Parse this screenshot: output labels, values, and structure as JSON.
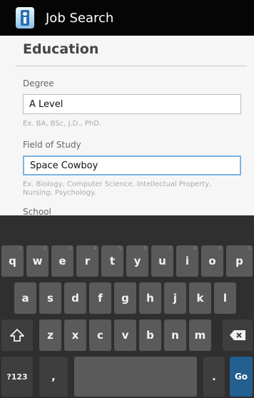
{
  "app": {
    "title": "Job Search",
    "icon": "job-search-app-icon"
  },
  "form": {
    "section_title": "Education",
    "degree": {
      "label": "Degree",
      "value": "A Level",
      "hint": "Ex. BA, BSc, J.D., PhD."
    },
    "field_of_study": {
      "label": "Field of Study",
      "value": "Space Cowboy",
      "hint": "Ex. Biology, Computer Science, Intellectual Property, Nursing, Psychology."
    },
    "school": {
      "label": "School"
    }
  },
  "keyboard": {
    "row1": [
      "q",
      "w",
      "e",
      "r",
      "t",
      "y",
      "u",
      "i",
      "o",
      "p"
    ],
    "row1_numbers": [
      "1",
      "2",
      "3",
      "4",
      "5",
      "6",
      "7",
      "8",
      "9",
      "0"
    ],
    "row2": [
      "a",
      "s",
      "d",
      "f",
      "g",
      "h",
      "j",
      "k",
      "l"
    ],
    "row3": [
      "z",
      "x",
      "c",
      "v",
      "b",
      "n",
      "m"
    ],
    "symbols_key": "?123",
    "comma_key": ",",
    "period_key": ".",
    "go_key": "Go",
    "shift_icon": "shift-arrow-icon",
    "backspace_icon": "backspace-icon"
  },
  "colors": {
    "title_bar": "#050505",
    "form_bg": "#f6f6f6",
    "focus_border": "#7bb2e0",
    "keyboard_bg": "#2f2f2f",
    "key": "#5a5a5a",
    "go_key": "#235f8f"
  }
}
